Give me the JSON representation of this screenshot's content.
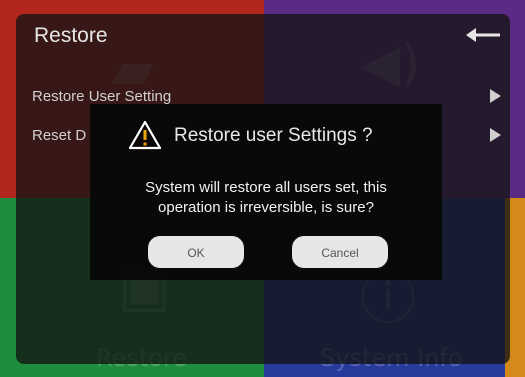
{
  "background": {
    "tiles": [
      {
        "name": "restore",
        "label": "Restore",
        "color": "#1e8e3e",
        "icon": "restore-icon"
      },
      {
        "name": "system-info",
        "label": "System Info",
        "color": "#283a9c",
        "icon": "info-icon"
      },
      {
        "name": "picture",
        "label": "",
        "color": "#b3261e",
        "icon": "image-icon"
      },
      {
        "name": "sound",
        "label": "",
        "color": "#5b2a86",
        "icon": "speaker-icon"
      }
    ]
  },
  "panel": {
    "title": "Restore",
    "back_icon": "back-arrow-icon",
    "items": [
      {
        "label": "Restore User Setting"
      },
      {
        "label": "Reset D"
      }
    ]
  },
  "dialog": {
    "icon": "warning-icon",
    "title": "Restore user Settings ?",
    "message_line1": "System will restore all users set, this",
    "message_line2": "operation is irreversible, is sure?",
    "ok_label": "OK",
    "cancel_label": "Cancel"
  },
  "colors": {
    "warning": "#f2a20c",
    "button_bg": "#e6e6e6"
  }
}
